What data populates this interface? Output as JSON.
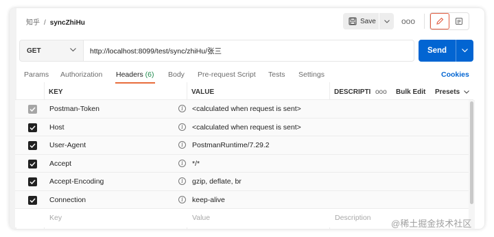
{
  "breadcrumb": {
    "parent": "知乎",
    "separator": "/",
    "current": "syncZhiHu"
  },
  "toolbar": {
    "save_label": "Save",
    "more": "ooo"
  },
  "request": {
    "method": "GET",
    "url": "http://localhost:8099/test/sync/zhiHu/张三",
    "send_label": "Send"
  },
  "tabs": {
    "params": "Params",
    "authorization": "Authorization",
    "headers": "Headers",
    "headers_count": "(6)",
    "body": "Body",
    "prerequest": "Pre-request Script",
    "tests": "Tests",
    "settings": "Settings",
    "cookies": "Cookies"
  },
  "table": {
    "columns": {
      "key": "KEY",
      "value": "VALUE",
      "description": "DESCRIPTI",
      "more": "ooo",
      "bulk_edit": "Bulk Edit",
      "presets": "Presets"
    },
    "rows": [
      {
        "checked": true,
        "disabled": true,
        "key": "Postman-Token",
        "value": "<calculated when request is sent>"
      },
      {
        "checked": true,
        "disabled": false,
        "key": "Host",
        "value": "<calculated when request is sent>"
      },
      {
        "checked": true,
        "disabled": false,
        "key": "User-Agent",
        "value": "PostmanRuntime/7.29.2"
      },
      {
        "checked": true,
        "disabled": false,
        "key": "Accept",
        "value": "*/*"
      },
      {
        "checked": true,
        "disabled": false,
        "key": "Accept-Encoding",
        "value": "gzip, deflate, br"
      },
      {
        "checked": true,
        "disabled": false,
        "key": "Connection",
        "value": "keep-alive"
      }
    ],
    "new_row": {
      "key_placeholder": "Key",
      "value_placeholder": "Value",
      "description_placeholder": "Description"
    }
  },
  "watermark": "@稀土掘金技术社区",
  "colors": {
    "send": "#0265d2",
    "active_tab": "#e86b3a",
    "count": "#1e8a4c",
    "cookies": "#0265d2"
  }
}
